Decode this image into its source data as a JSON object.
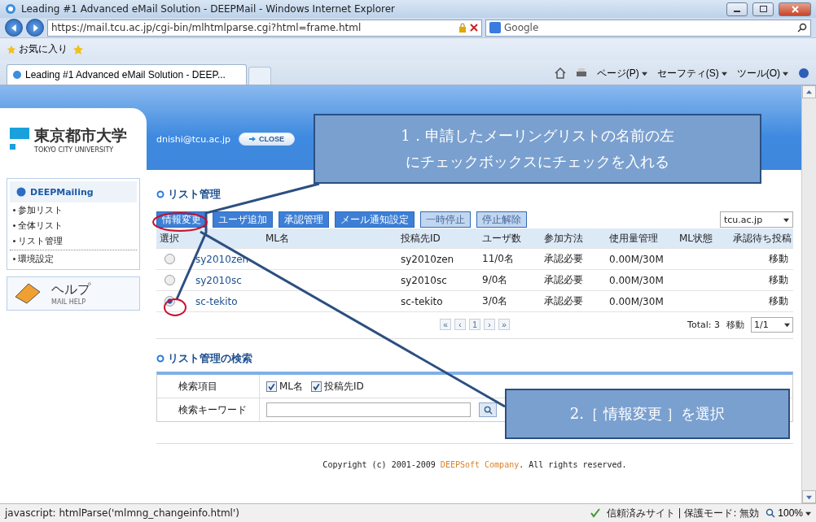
{
  "browser": {
    "title": "Leading #1 Advanced eMail Solution - DEEPMail - Windows Internet Explorer",
    "url": "https://mail.tcu.ac.jp/cgi-bin/mlhtmlparse.cgi?html=frame.html",
    "search_placeholder": "Google",
    "favorites": "お気に入り",
    "tab_title": "Leading #1 Advanced eMail Solution - DEEP...",
    "commands": [
      "ページ(P)",
      "セーフティ(S)",
      "ツール(O)"
    ],
    "status_text": "javascript: htmlParse('mlmng_changeinfo.html')",
    "status_zone": "信頼済みサイト | 保護モード: 無効",
    "zoom": "100%"
  },
  "header": {
    "logo_jp": "東京都市大学",
    "logo_en": "TOKYO CITY UNIVERSITY",
    "user": "dnishi@tcu.ac.jp",
    "close_label": "CLOSE"
  },
  "sidebar": {
    "title": "DEEPMailing",
    "items": [
      "参加リスト",
      "全体リスト",
      "リスト管理",
      "環境設定"
    ],
    "help_title": "ヘルプ",
    "help_sub": "MAIL HELP"
  },
  "list": {
    "title": "リスト管理",
    "buttons": [
      {
        "label": "情報変更",
        "disabled": false
      },
      {
        "label": "ユーザ追加",
        "disabled": false
      },
      {
        "label": "承認管理",
        "disabled": false
      },
      {
        "label": "メール通知設定",
        "disabled": false
      },
      {
        "label": "一時停止",
        "disabled": true
      },
      {
        "label": "停止解除",
        "disabled": true
      }
    ],
    "domain": "tcu.ac.jp",
    "columns": [
      "選択",
      "ML名",
      "投稿先ID",
      "ユーザ数",
      "参加方法",
      "使用量管理",
      "ML状態",
      "承認待ち投稿"
    ],
    "rows": [
      {
        "selected": false,
        "name": "sy2010zen",
        "poster": "sy2010zen",
        "users": "11/0名",
        "method": "承認必要",
        "usage": "0.00M/30M",
        "pending": "移動"
      },
      {
        "selected": false,
        "name": "sy2010sc",
        "poster": "sy2010sc",
        "users": "9/0名",
        "method": "承認必要",
        "usage": "0.00M/30M",
        "pending": "移動"
      },
      {
        "selected": true,
        "name": "sc-tekito",
        "poster": "sc-tekito",
        "users": "3/0名",
        "method": "承認必要",
        "usage": "0.00M/30M",
        "pending": "移動"
      }
    ],
    "pager": [
      "«",
      "‹",
      "1",
      "›",
      "»"
    ],
    "total": "Total: 3",
    "move": "移動",
    "page": "1/1"
  },
  "search": {
    "title": "リスト管理の検索",
    "item_label": "検索項目",
    "options": [
      {
        "label": "ML名",
        "checked": true
      },
      {
        "label": "投稿先ID",
        "checked": true
      }
    ],
    "keyword_label": "検索キーワード"
  },
  "footer": {
    "prefix": "Copyright (c) 2001-2009 ",
    "company": "DEEPSoft Company",
    "suffix": ". All rights reserved."
  },
  "callouts": [
    {
      "lines": [
        "1．申請したメーリングリストの名前の左",
        "にチェックボックスにチェックを入れる"
      ]
    },
    {
      "lines": [
        "2.［ 情報変更 ］を選択"
      ]
    }
  ]
}
